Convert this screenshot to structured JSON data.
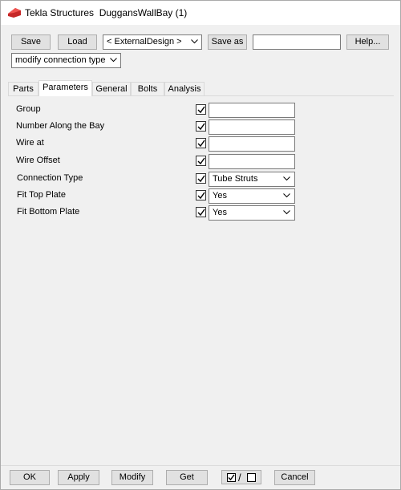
{
  "window": {
    "title": "Tekla Structures  DuggansWallBay (1)"
  },
  "toolbar": {
    "save_label": "Save",
    "load_label": "Load",
    "attribute_set": "< ExternalDesign >",
    "save_as_label": "Save as",
    "save_as_value": "",
    "help_label": "Help...",
    "mode_select": "modify connection type"
  },
  "tabs": [
    {
      "label": "Parts"
    },
    {
      "label": "Parameters"
    },
    {
      "label": "General"
    },
    {
      "label": "Bolts"
    },
    {
      "label": "Analysis"
    }
  ],
  "active_tab": "Parameters",
  "parameters": [
    {
      "label": "Group",
      "checked": true,
      "value": ""
    },
    {
      "label": "Number Along the Bay",
      "checked": true,
      "value": ""
    },
    {
      "label": "Wire at",
      "checked": true,
      "value": ""
    },
    {
      "label": "Wire Offset",
      "checked": true,
      "value": ""
    },
    {
      "label": "Connection Type",
      "checked": true,
      "value": "Tube Struts"
    },
    {
      "label": "Fit Top Plate",
      "checked": true,
      "value": "Yes"
    },
    {
      "label": "Fit Bottom Plate",
      "checked": true,
      "value": "Yes"
    }
  ],
  "footer": {
    "ok_label": "OK",
    "apply_label": "Apply",
    "modify_label": "Modify",
    "get_label": "Get",
    "toggle_separator": "/",
    "cancel_label": "Cancel"
  },
  "colors": {
    "app_icon": "#d32f2f",
    "window_bg": "#f0f0f0",
    "button_bg": "#e1e1e1"
  }
}
